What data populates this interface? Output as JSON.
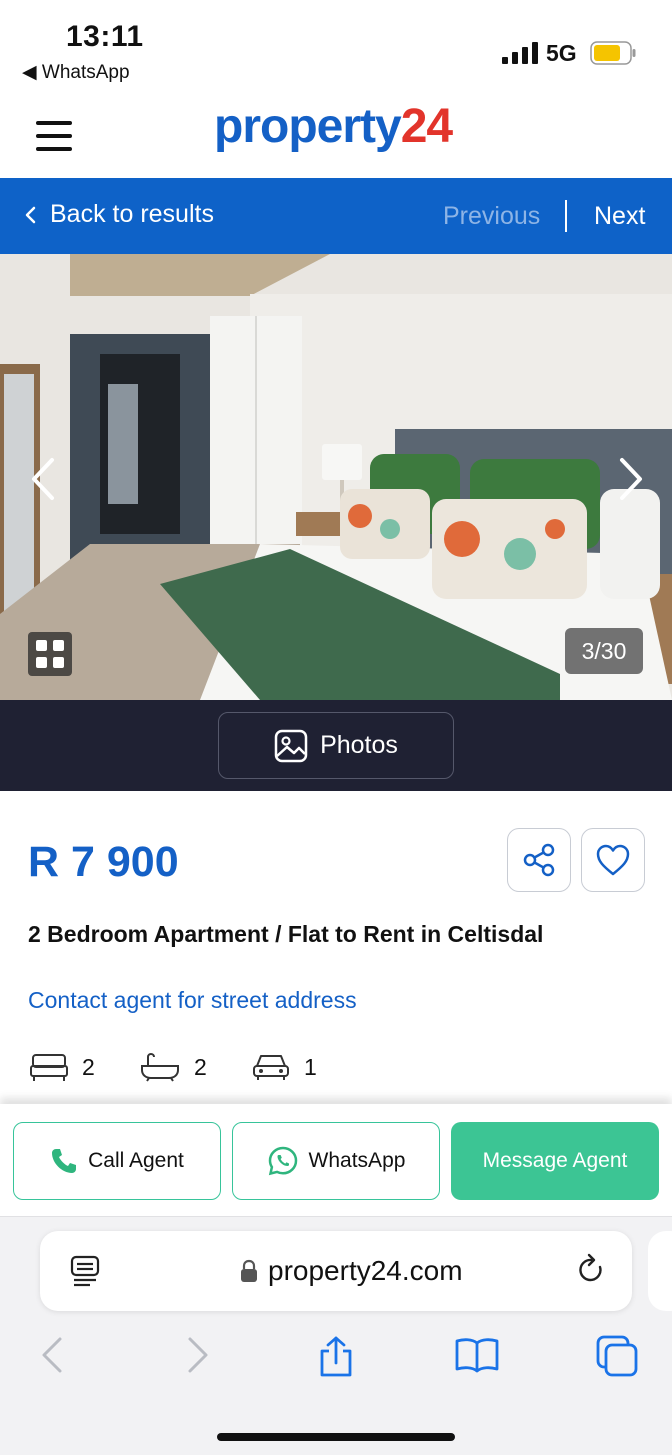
{
  "status_bar": {
    "time": "13:11",
    "back_app": "◀ WhatsApp",
    "network": "5G"
  },
  "header": {
    "logo_main": "property",
    "logo_num": "24",
    "menu_icon": "hamburger-menu-icon"
  },
  "results_nav": {
    "back_label": "Back to results",
    "previous_label": "Previous",
    "next_label": "Next"
  },
  "gallery": {
    "counter": "3/30",
    "photos_label": "Photos"
  },
  "listing": {
    "price": "R 7 900",
    "title": "2 Bedroom Apartment / Flat to Rent in Celtisdal",
    "address_link": "Contact agent for street address",
    "bedrooms": "2",
    "bathrooms": "2",
    "parking": "1"
  },
  "actions": {
    "call_label": "Call Agent",
    "whatsapp_label": "WhatsApp",
    "message_label": "Message Agent"
  },
  "browser": {
    "url": "property24.com"
  },
  "colors": {
    "brand_blue": "#1460c6",
    "brand_red": "#e2342b",
    "nav_blue": "#0e62c8",
    "accent_green": "#3cc594"
  }
}
